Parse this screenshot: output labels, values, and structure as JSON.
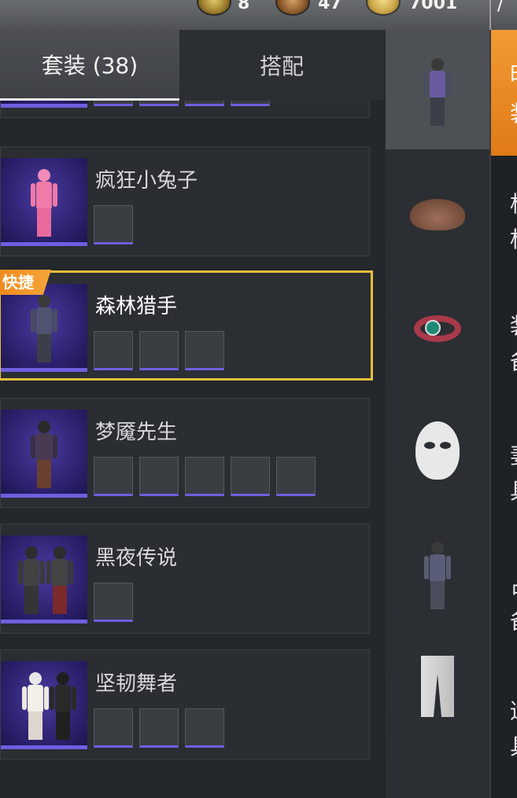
{
  "currency": {
    "coin1_value": "8",
    "coin2_value": "47",
    "coin3_value": "7001",
    "close_symbol": "/"
  },
  "tabs": {
    "suits_label": "套装 (38)",
    "combo_label": "搭配"
  },
  "suits": [
    {
      "name": "",
      "items": 4
    },
    {
      "name": "疯狂小兔子",
      "items": 1
    },
    {
      "name": "森林猎手",
      "badge": "快捷",
      "selected": true,
      "items": 3
    },
    {
      "name": "梦魇先生",
      "items": 5
    },
    {
      "name": "黑夜传说",
      "items": 1
    },
    {
      "name": "坚韧舞者",
      "items": 3
    }
  ],
  "equipped": {
    "slots": [
      "outfit-icon",
      "hat-icon",
      "ring-icon",
      "mask-icon",
      "outfit-icon",
      "pants-icon"
    ]
  },
  "side_panel": {
    "lines": [
      "时",
      "装",
      "柞",
      "柞",
      "装",
      "备",
      "妻",
      "具",
      "占",
      "备",
      "适",
      "具"
    ]
  },
  "colors": {
    "selected_border": "#e8bf3c",
    "badge_orange": "#f08a1c",
    "rarity_purple": "#6d5fe0"
  }
}
